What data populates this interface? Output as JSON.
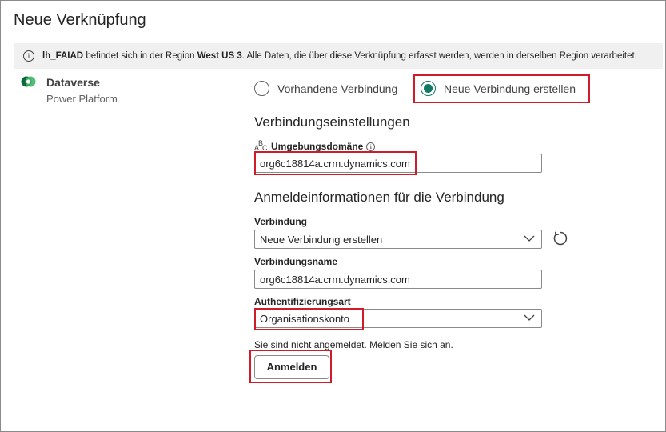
{
  "dialog": {
    "title": "Neue Verknüpfung"
  },
  "info": {
    "icon": "info-icon",
    "lakehouse": "lh_FAIAD",
    "text_before_region": " befindet sich in der Region ",
    "region": "West US 3",
    "text_after_region": ". Alle Daten, die über diese Verknüpfung erfasst werden, werden in derselben Region verarbeitet."
  },
  "source": {
    "name": "Dataverse",
    "subtitle": "Power Platform",
    "icon": "dataverse-logo-icon"
  },
  "connection_mode": {
    "options": [
      {
        "label": "Vorhandene Verbindung",
        "checked": false
      },
      {
        "label": "Neue Verbindung erstellen",
        "checked": true
      }
    ]
  },
  "settings": {
    "heading": "Verbindungseinstellungen",
    "domain_label": "Umgebungsdomäne",
    "domain_type_icon": "A B C",
    "domain_value": "org6c18814a.crm.dynamics.com"
  },
  "credentials": {
    "heading": "Anmeldeinformationen für die Verbindung",
    "connection_label": "Verbindung",
    "connection_value": "Neue Verbindung erstellen",
    "name_label": "Verbindungsname",
    "name_value": "org6c18814a.crm.dynamics.com",
    "auth_label": "Authentifizierungsart",
    "auth_value": "Organisationskonto",
    "signin_message": "Sie sind nicht angemeldet. Melden Sie sich an.",
    "signin_button": "Anmelden"
  },
  "colors": {
    "accent": "#117865",
    "highlight": "#d01c2a"
  }
}
